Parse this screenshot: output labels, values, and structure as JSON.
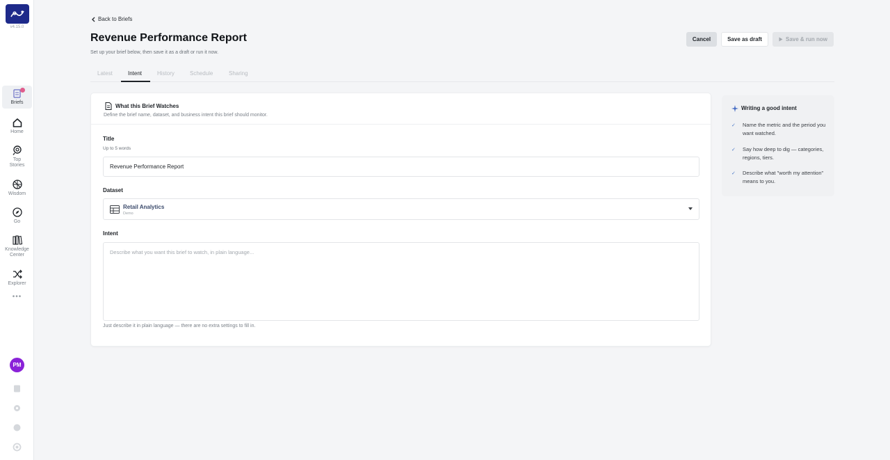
{
  "app": {
    "version": "v4.15.0",
    "colors": {
      "brand": "#1e2a8a",
      "avatar": "#8a22d8",
      "badge": "#e05d8c",
      "check": "#4a78c8"
    }
  },
  "sidebar": {
    "items": [
      {
        "label": "Briefs",
        "icon": "briefs-icon",
        "active": true
      },
      {
        "label": "Home",
        "icon": "home-icon"
      },
      {
        "label": "Top Stories",
        "icon": "top-stories-icon"
      },
      {
        "label": "Wisdom",
        "icon": "wisdom-icon"
      },
      {
        "label": "Go",
        "icon": "compass-icon"
      },
      {
        "label": "Knowledge Center",
        "icon": "knowledge-icon"
      },
      {
        "label": "Explorer",
        "icon": "shuffle-icon"
      }
    ],
    "more": "•••",
    "avatar_initials": "PM"
  },
  "header": {
    "back_label": "Back to Briefs",
    "title": "Revenue Performance Report",
    "subtitle": "Set up your brief below, then save it as a draft or run it now.",
    "cancel_label": "Cancel",
    "draft_label": "Save as draft",
    "run_label": "Save & run now"
  },
  "tabs": {
    "latest": "Latest",
    "intent": "Intent",
    "history": "History",
    "schedule": "Schedule",
    "sharing": "Sharing",
    "active": "Intent"
  },
  "card": {
    "title": "What this Brief Watches",
    "description": "Define the brief name, dataset, and business intent this brief should monitor.",
    "title_field": {
      "label": "Title",
      "hint": "Up to 5 words",
      "value": "Revenue Performance Report"
    },
    "dataset_field": {
      "label": "Dataset",
      "selected_name": "Retail Analytics",
      "selected_sub": "Demo"
    },
    "intent_field": {
      "label": "Intent",
      "placeholder": "Describe what you want this brief to watch, in plain language...",
      "note": "Just describe it in plain language — there are no extra settings to fill in."
    }
  },
  "tips": {
    "title": "Writing a good intent",
    "items": [
      "Name the metric and the period you want watched.",
      "Say how deep to dig — categories, regions, tiers.",
      "Describe what \"worth my attention\" means to you."
    ]
  }
}
